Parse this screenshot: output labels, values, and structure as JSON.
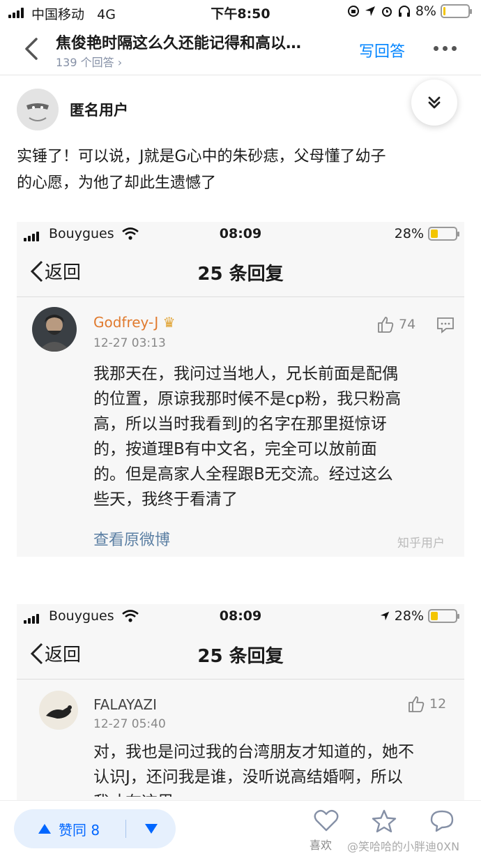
{
  "status_bar": {
    "carrier": "中国移动",
    "network": "4G",
    "time": "下午8:50",
    "battery": "8%",
    "battery_level": 0.08
  },
  "nav": {
    "title": "焦俊艳时隔这么久还能记得和高以…",
    "answer_count": "139 个回答 ›",
    "write_answer": "写回答"
  },
  "author": {
    "name": "匿名用户"
  },
  "answer": {
    "text": [
      "实锤了！可以说，J就是G心中的朱砂痣，父母懂了幼子",
      "的心愿，为他了却此生遗憾了"
    ]
  },
  "screenshots": [
    {
      "status": {
        "carrier": "Bouygues",
        "time": "08:09",
        "battery": "28%",
        "battery_level": 0.28
      },
      "nav": {
        "back": "返回",
        "title": "25 条回复"
      },
      "comment": {
        "user": "Godfrey-J",
        "time": "12-27 03:13",
        "likes": "74",
        "body": [
          "我那天在，我问过当地人，兄长前面是配偶",
          "的位置，原谅我那时候不是cp粉，我只粉高",
          "高，所以当时我看到J的名字在那里挺惊讶",
          "的，按道理B有中文名，完全可以放前面",
          "的。但是高家人全程跟B无交流。经过这么",
          "些天，我终于看清了"
        ],
        "link": "查看原微博",
        "watermark": "知乎用户"
      }
    },
    {
      "status": {
        "carrier": "Bouygues",
        "time": "08:09",
        "battery": "28%",
        "battery_level": 0.28
      },
      "nav": {
        "back": "返回",
        "title": "25 条回复"
      },
      "comment": {
        "user": "FALAYAZI",
        "time": "12-27 05:40",
        "likes": "12",
        "body": [
          "对，我也是问过我的台湾朋友才知道的，她不",
          "认识J，还问我是谁，没听说高结婚啊，所以",
          "我才在这里"
        ]
      }
    }
  ],
  "bottom_bar": {
    "vote_label": "赞同 8",
    "like_label": "喜欢",
    "watermark": "@笑哈哈的小胖迪0XN"
  },
  "colors": {
    "accent": "#0084ff",
    "vote_bg": "#e6f0fd",
    "username_orange": "#e07a2e"
  }
}
